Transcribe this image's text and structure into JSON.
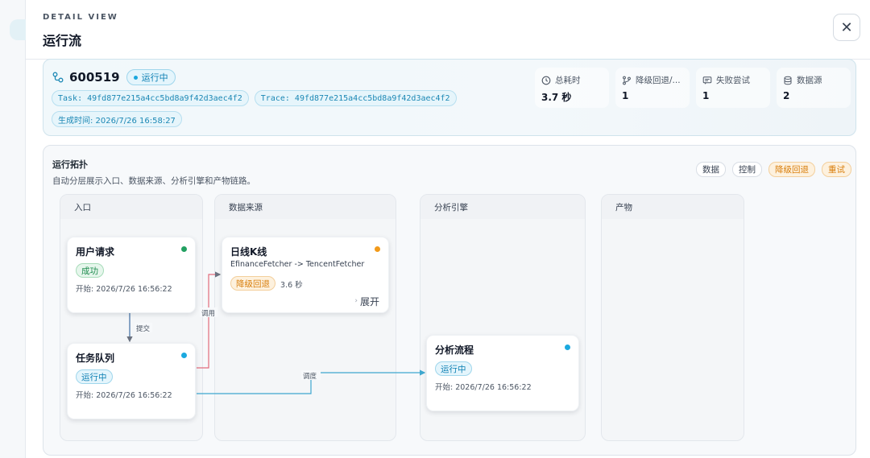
{
  "header": {
    "eyebrow": "DETAIL VIEW",
    "title": "运行流",
    "close_glyph": "✕"
  },
  "summary": {
    "symbol": "600519",
    "status": "运行中",
    "task": "Task: 49fd877e215a4cc5bd8a9f42d3aec4f2",
    "trace": "Trace: 49fd877e215a4cc5bd8a9f42d3aec4f2",
    "generated": "生成时间: 2026/7/26 16:58:27",
    "stats": [
      {
        "label": "总耗时",
        "value": "3.7 秒",
        "icon": "clock-icon"
      },
      {
        "label": "降级回退/...",
        "value": "1",
        "icon": "branch-icon"
      },
      {
        "label": "失败尝试",
        "value": "1",
        "icon": "message-icon"
      },
      {
        "label": "数据源",
        "value": "2",
        "icon": "database-icon"
      }
    ]
  },
  "topology": {
    "title": "运行拓扑",
    "subtitle": "自动分层展示入口、数据来源、分析引擎和产物链路。",
    "legend": [
      "数据",
      "控制",
      "降级回退",
      "重试"
    ],
    "lanes": [
      "入口",
      "数据来源",
      "分析引擎",
      "产物"
    ],
    "nodes": {
      "user_request": {
        "title": "用户请求",
        "status": "成功",
        "start": "开始: 2026/7/26 16:56:22"
      },
      "task_queue": {
        "title": "任务队列",
        "status": "运行中",
        "start": "开始: 2026/7/26 16:56:22"
      },
      "daily_kline": {
        "title": "日线K线",
        "desc": "EfinanceFetcher -> TencentFetcher",
        "status": "降级回退",
        "duration": "3.6 秒",
        "expand": "展开"
      },
      "analysis_flow": {
        "title": "分析流程",
        "status": "运行中",
        "start": "开始: 2026/7/26 16:56:22"
      }
    },
    "edges": {
      "submit": "提交",
      "call": "调用",
      "dispatch": "调度"
    }
  },
  "colors": {
    "success_dot": "#22a061",
    "running_dot": "#1ba9df",
    "fallback_dot": "#f29a1a",
    "data_edge": "#3ea7cf",
    "fallback_edge": "#e26b7c",
    "control_edge": "#6b7280"
  }
}
